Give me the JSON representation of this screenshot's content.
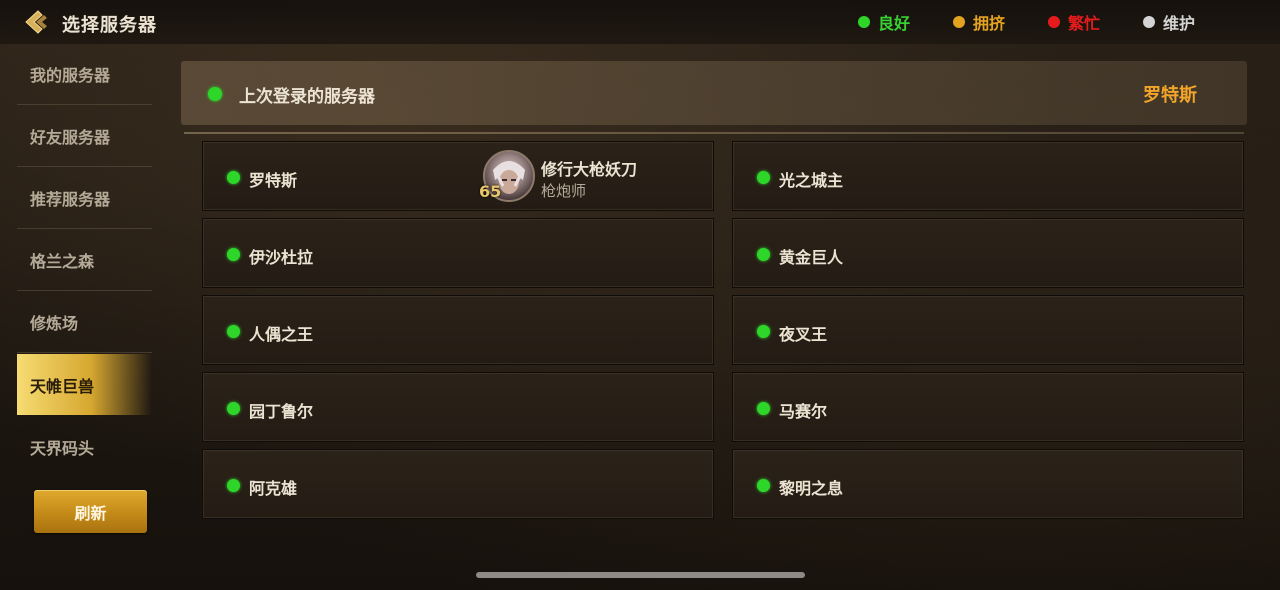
{
  "header": {
    "title": "选择服务器",
    "back_icon": "back-arrow-icon"
  },
  "legend": [
    {
      "label": "良好",
      "color": "#2ed62a",
      "text_color": "#39d233"
    },
    {
      "label": "拥挤",
      "color": "#e3a21f",
      "text_color": "#e3a21f"
    },
    {
      "label": "繁忙",
      "color": "#e61b1b",
      "text_color": "#e61b1b"
    },
    {
      "label": "维护",
      "color": "#d4d4d4",
      "text_color": "#d4d4d4"
    }
  ],
  "sidebar": {
    "items": [
      {
        "label": "我的服务器",
        "active": false
      },
      {
        "label": "好友服务器",
        "active": false
      },
      {
        "label": "推荐服务器",
        "active": false
      },
      {
        "label": "格兰之森",
        "active": false
      },
      {
        "label": "修炼场",
        "active": false
      },
      {
        "label": "天帷巨兽",
        "active": true
      },
      {
        "label": "天界码头",
        "active": false
      }
    ],
    "refresh_label": "刷新"
  },
  "last_login": {
    "label": "上次登录的服务器",
    "server": "罗特斯"
  },
  "servers": [
    {
      "name": "罗特斯",
      "status": "良好",
      "character": {
        "name": "修行大枪妖刀",
        "class": "枪炮师",
        "level": "65"
      }
    },
    {
      "name": "光之城主",
      "status": "良好"
    },
    {
      "name": "伊沙杜拉",
      "status": "良好"
    },
    {
      "name": "黄金巨人",
      "status": "良好"
    },
    {
      "name": "人偶之王",
      "status": "良好"
    },
    {
      "name": "夜叉王",
      "status": "良好"
    },
    {
      "name": "园丁鲁尔",
      "status": "良好"
    },
    {
      "name": "马赛尔",
      "status": "良好"
    },
    {
      "name": "阿克雄",
      "status": "良好"
    },
    {
      "name": "黎明之息",
      "status": "良好"
    }
  ]
}
